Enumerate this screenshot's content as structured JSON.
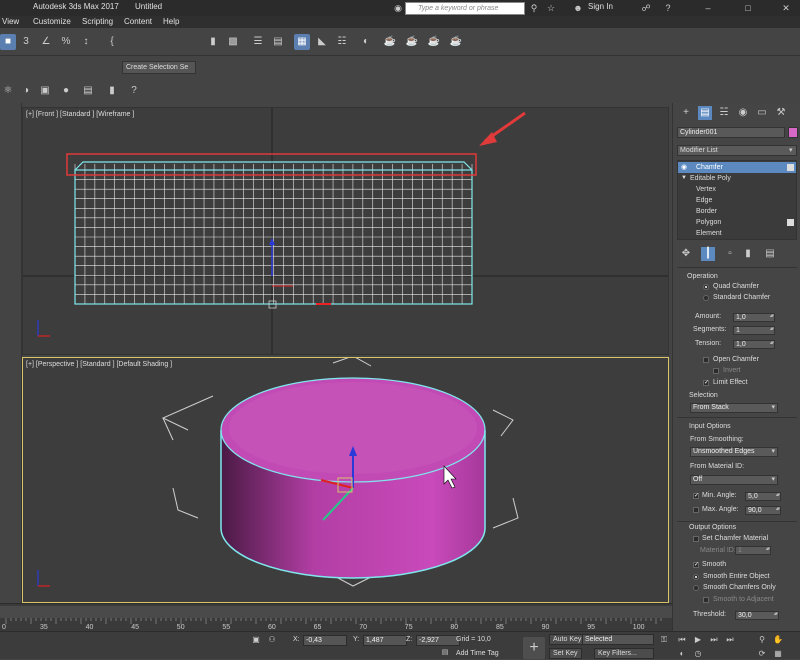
{
  "titlebar": {
    "app_title": "Autodesk 3ds Max 2017",
    "doc_title": "Untitled",
    "search_placeholder": "Type a keyword or phrase",
    "sign_in": "Sign In"
  },
  "menubar": {
    "items": [
      "View",
      "Customize",
      "Scripting",
      "Content",
      "Help"
    ]
  },
  "toolbar": {
    "selection_set": "Create Selection Se"
  },
  "viewports": {
    "front_label": "[+] [Front ] [Standard ] [Wireframe ]",
    "persp_label": "[+] [Perspective ] [Standard ] [Default Shading ]"
  },
  "command_panel": {
    "object_name": "Cylinder001",
    "object_color": "#d868c8",
    "modifier_list": "Modifier List",
    "stack": [
      {
        "label": "Chamfer",
        "selected": true
      },
      {
        "label": "Editable Poly",
        "selected": false
      },
      {
        "label": "Vertex",
        "selected": false
      },
      {
        "label": "Edge",
        "selected": false
      },
      {
        "label": "Border",
        "selected": false
      },
      {
        "label": "Polygon",
        "selected": false
      },
      {
        "label": "Element",
        "selected": false
      }
    ],
    "operation": {
      "title": "Operation",
      "quad_chamfer": "Quad Chamfer",
      "standard_chamfer": "Standard Chamfer",
      "amount_label": "Amount:",
      "amount": "1,0",
      "segments_label": "Segments:",
      "segments": "1",
      "tension_label": "Tension:",
      "tension": "1,0",
      "open_chamfer": "Open Chamfer",
      "invert": "Invert",
      "limit_effect": "Limit Effect"
    },
    "selection": {
      "title": "Selection",
      "from_stack": "From Stack"
    },
    "input_options": {
      "title": "Input Options",
      "from_smoothing_label": "From Smoothing:",
      "from_smoothing": "Unsmoothed Edges",
      "from_material_label": "From Material ID:",
      "from_material": "Off",
      "min_angle_label": "Min. Angle:",
      "min_angle": "5,0",
      "max_angle_label": "Max. Angle:",
      "max_angle": "90,0"
    },
    "output_options": {
      "title": "Output Options",
      "set_chamfer_material": "Set Chamfer Material",
      "material_id_label": "Material ID:",
      "material_id": "1",
      "smooth": "Smooth",
      "smooth_entire": "Smooth Entire Object",
      "smooth_chamfers": "Smooth Chamfers Only",
      "smooth_adjacent": "Smooth to Adjacent",
      "threshold_label": "Threshold:",
      "threshold": "30,0"
    }
  },
  "timeline": {
    "ticks": [
      "0",
      "35",
      "40",
      "45",
      "50",
      "55",
      "60",
      "65",
      "70",
      "75",
      "80",
      "85",
      "90",
      "95",
      "100"
    ]
  },
  "statusbar": {
    "x_label": "X:",
    "x_value": "-0,43",
    "y_label": "Y:",
    "y_value": "1,487",
    "z_label": "Z:",
    "z_value": "-2,927",
    "grid": "Grid = 10,0",
    "add_time_tag": "Add Time Tag",
    "auto_key": "Auto Key",
    "selected": "Selected",
    "set_key": "Set Key",
    "key_filters": "Key Filters..."
  },
  "colors": {
    "object_magenta": "#c24ab4",
    "highlight_red": "#e03a3a",
    "selection_blue": "#5c8ac0",
    "viewport_border_active": "#d8c46a"
  }
}
